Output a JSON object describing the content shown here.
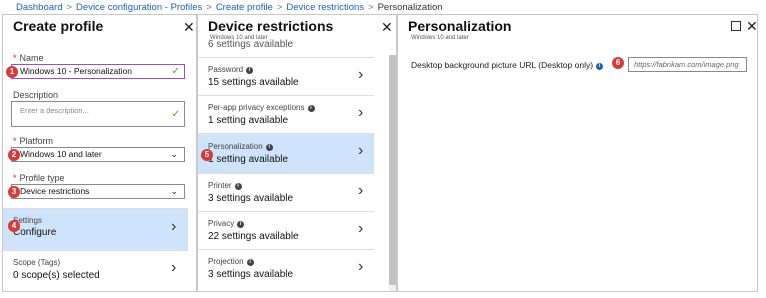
{
  "breadcrumb": [
    "Dashboard",
    "Device configuration - Profiles",
    "Create profile",
    "Device restrictions",
    "Personalization"
  ],
  "create_profile": {
    "title": "Create profile",
    "name_label": "Name",
    "name_value": "Windows 10 - Personalization",
    "description_label": "Description",
    "description_placeholder": "Enter a description...",
    "platform_label": "Platform",
    "platform_value": "Windows 10 and later",
    "profile_type_label": "Profile type",
    "profile_type_value": "Device restrictions",
    "settings_label": "Settings",
    "settings_value": "Configure",
    "scope_label": "Scope (Tags)",
    "scope_value": "0 scope(s) selected"
  },
  "device_restrictions": {
    "title": "Device restrictions",
    "subtitle": "Windows 10 and later",
    "items": [
      {
        "label": "",
        "value": "6 settings available"
      },
      {
        "label": "Password",
        "value": "15 settings available"
      },
      {
        "label": "Per-app privacy exceptions",
        "value": "1 setting available"
      },
      {
        "label": "Personalization",
        "value": "1 setting available"
      },
      {
        "label": "Printer",
        "value": "3 settings available"
      },
      {
        "label": "Privacy",
        "value": "22 settings available"
      },
      {
        "label": "Projection",
        "value": "3 settings available"
      }
    ]
  },
  "personalization": {
    "title": "Personalization",
    "subtitle": "Windows 10 and later",
    "field_label": "Desktop background picture URL (Desktop only)",
    "field_placeholder": "https://fabrikam.com/image.png"
  },
  "markers": [
    "1",
    "2",
    "3",
    "4",
    "5",
    "6"
  ],
  "icons": {
    "close": "close-icon",
    "maximize": "maximize-icon",
    "chevron_right": "chevron-right-icon",
    "chevron_down": "chevron-down-icon",
    "check": "check-icon",
    "info": "info-icon"
  },
  "colors": {
    "selected_bg": "#cfe4fa",
    "link": "#1d62b5",
    "marker": "#d73a3a",
    "check": "#5aa31a",
    "active_border": "#9b4fc7"
  }
}
